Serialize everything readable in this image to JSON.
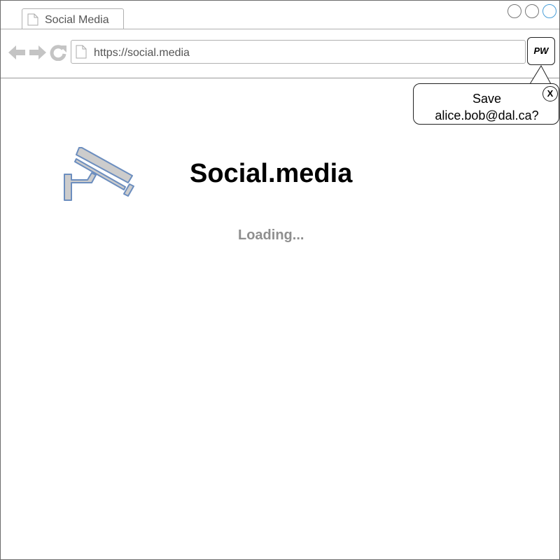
{
  "browser": {
    "tab": {
      "label": "Social Media",
      "icon": "page-icon"
    },
    "window_controls": [
      "minimize-button",
      "maximize-button",
      "close-button"
    ],
    "nav": {
      "back_icon": "back-arrow-icon",
      "forward_icon": "forward-arrow-icon",
      "reload_icon": "reload-icon"
    },
    "address_bar": {
      "url": "https://social.media",
      "icon": "page-icon"
    },
    "password_manager_button": {
      "label": "PW"
    }
  },
  "password_popup": {
    "line1": "Save",
    "line2": "alice.bob@dal.ca?",
    "close_label": "X"
  },
  "page": {
    "logo_icon": "security-camera-icon",
    "title": "Social.media",
    "status": "Loading..."
  },
  "colors": {
    "camera_fill": "#cccccc",
    "camera_stroke": "#6c8ebf",
    "loading_text": "#8f8f8f",
    "chrome_gray": "#b0b0b0"
  }
}
